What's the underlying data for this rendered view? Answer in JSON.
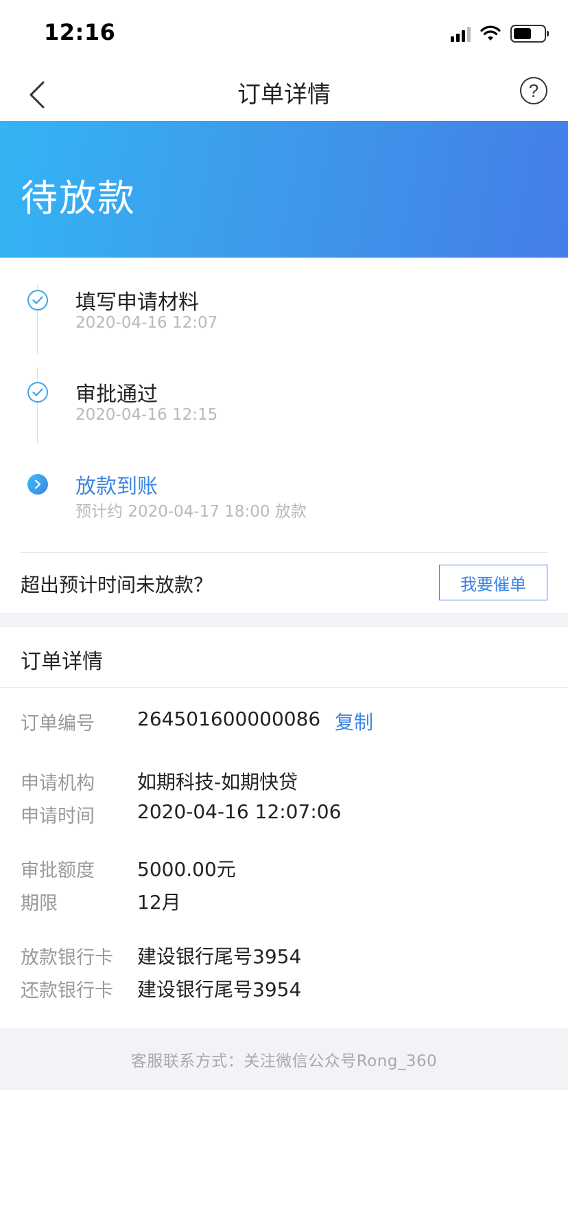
{
  "status_bar": {
    "time": "12:16"
  },
  "nav": {
    "title": "订单详情",
    "help_glyph": "?"
  },
  "banner": {
    "status": "待放款"
  },
  "timeline": [
    {
      "title": "填写申请材料",
      "subtitle": "2020-04-16 12:07",
      "state": "done"
    },
    {
      "title": "审批通过",
      "subtitle": "2020-04-16 12:15",
      "state": "done"
    },
    {
      "title": "放款到账",
      "subtitle": "预计约 2020-04-17 18:00 放款",
      "state": "current"
    }
  ],
  "urge": {
    "question": "超出预计时间未放款？",
    "button_label": "我要催单"
  },
  "order_details": {
    "section_title": "订单详情",
    "order_number_label": "订单编号",
    "order_number": "264501600000086",
    "copy_label": "复制",
    "institution_label": "申请机构",
    "institution": "如期科技-如期快贷",
    "apply_time_label": "申请时间",
    "apply_time": "2020-04-16 12:07:06",
    "approved_amount_label": "审批额度",
    "approved_amount": "5000.00元",
    "term_label": "期限",
    "term": "12月",
    "payout_card_label": "放款银行卡",
    "payout_card": "建设银行尾号3954",
    "repay_card_label": "还款银行卡",
    "repay_card": "建设银行尾号3954"
  },
  "footer": {
    "text": "客服联系方式：关注微信公众号Rong_360"
  },
  "colors": {
    "accent": "#3d86e3",
    "banner_start": "#34b4f5",
    "banner_end": "#447ee7",
    "muted_text": "#9a9a9a"
  }
}
